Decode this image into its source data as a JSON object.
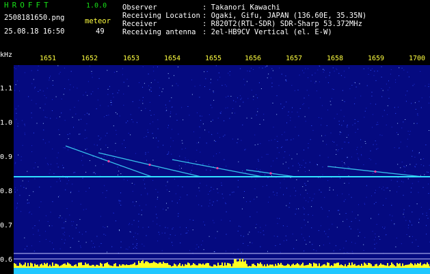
{
  "app": {
    "brand": "HROFFT",
    "version": "1.0.0",
    "filename": "2508181650.png",
    "datetime": "25.08.18 16:50",
    "counter_label": "meteor",
    "counter_value": "49"
  },
  "station": {
    "rows": [
      {
        "label": "Observer",
        "value": ": Takanori Kawachi"
      },
      {
        "label": "Receiving Location",
        "value": ": Ogaki, Gifu, JAPAN (136.60E, 35.35N)"
      },
      {
        "label": "Receiver",
        "value": ": R820T2(RTL-SDR) SDR-Sharp 53.372MHz"
      },
      {
        "label": "Receiving antenna",
        "value": ": 2el-HB9CV Vertical (el. E-W)"
      }
    ]
  },
  "spectrogram": {
    "y_unit": "kHz",
    "y_ticks": [
      "1.1",
      "1.0",
      "0.9",
      "0.8",
      "0.7",
      "0.6"
    ],
    "x_ticks": [
      "1651",
      "1652",
      "1653",
      "1654",
      "1655",
      "1656",
      "1657",
      "1658",
      "1659",
      "1700"
    ],
    "background_color": "#050a80",
    "carrier_khz": 0.84,
    "meteor_echoes": [
      {
        "start_min": 0.6,
        "end_min": 2.7,
        "start_khz": 0.93,
        "end_khz": 0.84
      },
      {
        "start_min": 1.4,
        "end_min": 3.9,
        "start_khz": 0.91,
        "end_khz": 0.84
      },
      {
        "start_min": 3.2,
        "end_min": 5.4,
        "start_khz": 0.89,
        "end_khz": 0.84
      },
      {
        "start_min": 5.0,
        "end_min": 6.2,
        "start_khz": 0.86,
        "end_khz": 0.84
      },
      {
        "start_min": 7.0,
        "end_min": 9.3,
        "start_khz": 0.87,
        "end_khz": 0.84
      }
    ]
  }
}
